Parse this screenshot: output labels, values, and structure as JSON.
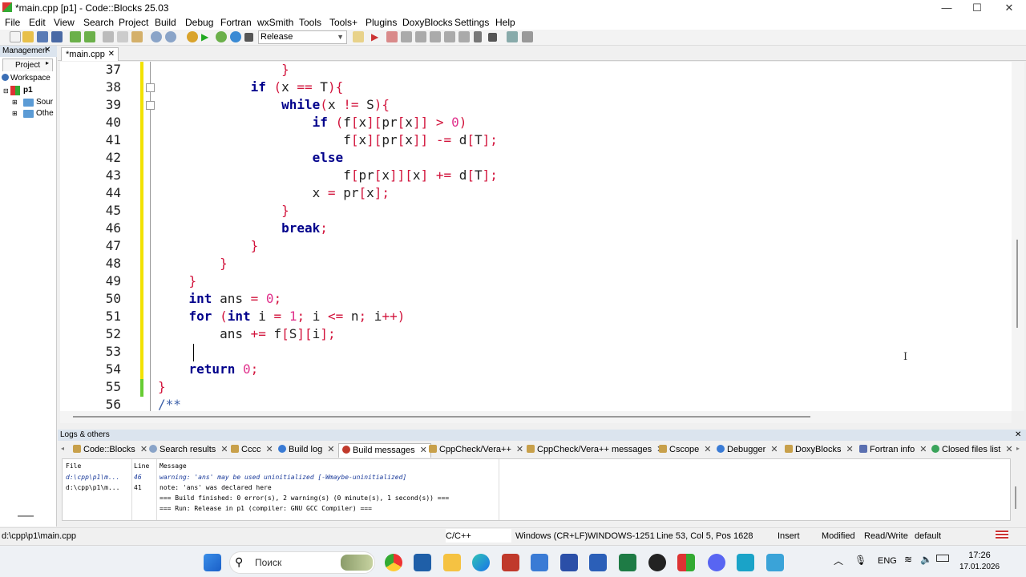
{
  "window": {
    "title": "*main.cpp [p1] - Code::Blocks 25.03",
    "minimize": "—",
    "maximize": "☐",
    "close": "✕"
  },
  "menu": [
    "File",
    "Edit",
    "View",
    "Search",
    "Project",
    "Build",
    "Debug",
    "Fortran",
    "wxSmith",
    "Tools",
    "Tools+",
    "Plugins",
    "DoxyBlocks",
    "Settings",
    "Help"
  ],
  "toolbar": {
    "build_target": "Release"
  },
  "left_panel": {
    "header": "Managemen",
    "tab": "Project",
    "workspace": "Workspace",
    "project": "p1",
    "folders": [
      "Sour",
      "Othe"
    ]
  },
  "editor": {
    "tab": "*main.cpp",
    "lines": [
      {
        "n": "37",
        "code": "                }"
      },
      {
        "n": "38",
        "code": "            if (x == T){"
      },
      {
        "n": "39",
        "code": "                while(x != S){"
      },
      {
        "n": "40",
        "code": "                    if (f[x][pr[x]] > 0)"
      },
      {
        "n": "41",
        "code": "                        f[x][pr[x]] -= d[T];"
      },
      {
        "n": "42",
        "code": "                    else"
      },
      {
        "n": "43",
        "code": "                        f[pr[x]][x] += d[T];"
      },
      {
        "n": "44",
        "code": "                    x = pr[x];"
      },
      {
        "n": "45",
        "code": "                }"
      },
      {
        "n": "46",
        "code": "                break;"
      },
      {
        "n": "47",
        "code": "            }"
      },
      {
        "n": "48",
        "code": "        }"
      },
      {
        "n": "49",
        "code": "    }"
      },
      {
        "n": "50",
        "code": "    int ans = 0;"
      },
      {
        "n": "51",
        "code": "    for (int i = 1; i <= n; i++)"
      },
      {
        "n": "52",
        "code": "        ans += f[S][i];"
      },
      {
        "n": "53",
        "code": "    "
      },
      {
        "n": "54",
        "code": "    return 0;"
      },
      {
        "n": "55",
        "code": "}"
      },
      {
        "n": "56",
        "code": "/**"
      }
    ]
  },
  "logs": {
    "header": "Logs & others",
    "tabs": [
      "Code::Blocks",
      "Search results",
      "Cccc",
      "Build log",
      "Build messages",
      "CppCheck/Vera++",
      "CppCheck/Vera++ messages",
      "Cscope",
      "Debugger",
      "DoxyBlocks",
      "Fortran info",
      "Closed files list"
    ],
    "active_tab": "Build messages",
    "columns": [
      "File",
      "Line",
      "Message"
    ],
    "rows": [
      {
        "file": "d:\\cpp\\p1\\m...",
        "line": "46",
        "message": "warning: 'ans' may be used uninitialized [-Wmaybe-uninitialized]"
      },
      {
        "file": "d:\\cpp\\p1\\m...",
        "line": "41",
        "message": "note: 'ans' was declared here"
      },
      {
        "file": "",
        "line": "",
        "message": "=== Build finished: 0 error(s), 2 warning(s) (0 minute(s), 1 second(s)) ==="
      },
      {
        "file": "",
        "line": "",
        "message": "=== Run: Release in p1 (compiler: GNU GCC Compiler) ==="
      }
    ]
  },
  "status": {
    "path": "d:\\cpp\\p1\\main.cpp",
    "language": "C/C++",
    "eol": "Windows (CR+LF)",
    "encoding": "WINDOWS-1251",
    "position": "Line 53, Col 5, Pos 1628",
    "mode": "Insert",
    "modified": "Modified",
    "access": "Read/Write",
    "profile": "default"
  },
  "taskbar": {
    "search_placeholder": "Поиск",
    "lang": "ENG",
    "time": "17:26",
    "date": "17.01.2026"
  }
}
